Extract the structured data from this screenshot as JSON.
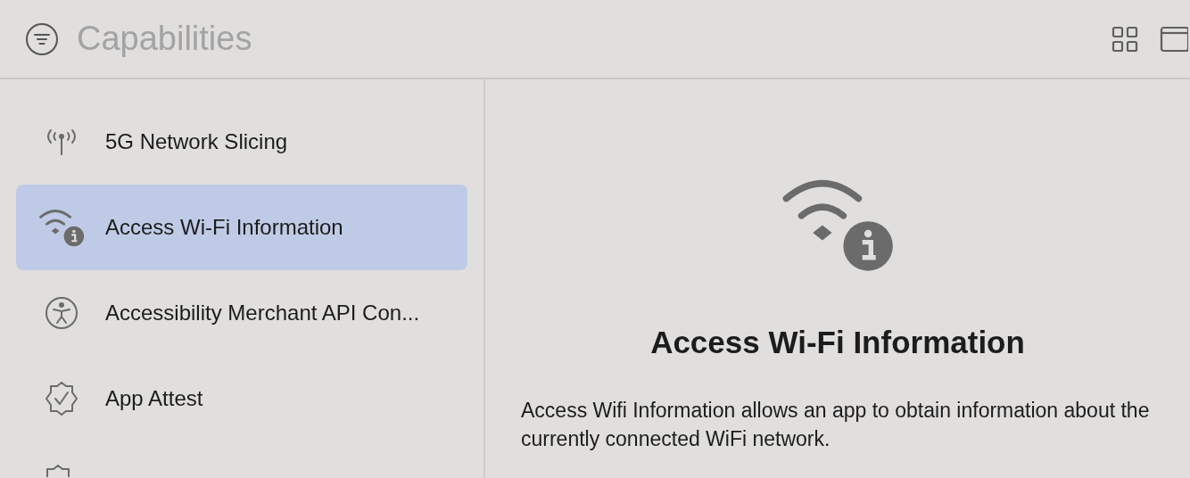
{
  "header": {
    "title": "Capabilities"
  },
  "sidebar": {
    "items": [
      {
        "label": "5G Network Slicing",
        "kind": "antenna",
        "selected": false
      },
      {
        "label": "Access Wi-Fi Information",
        "kind": "wifi",
        "selected": true
      },
      {
        "label": "Accessibility Merchant API Con...",
        "kind": "accessibility",
        "selected": false
      },
      {
        "label": "App Attest",
        "kind": "badge",
        "selected": false
      }
    ]
  },
  "detail": {
    "title": "Access Wi-Fi Information",
    "description": "Access Wifi Information allows an app to obtain information about the currently connected WiFi network."
  }
}
